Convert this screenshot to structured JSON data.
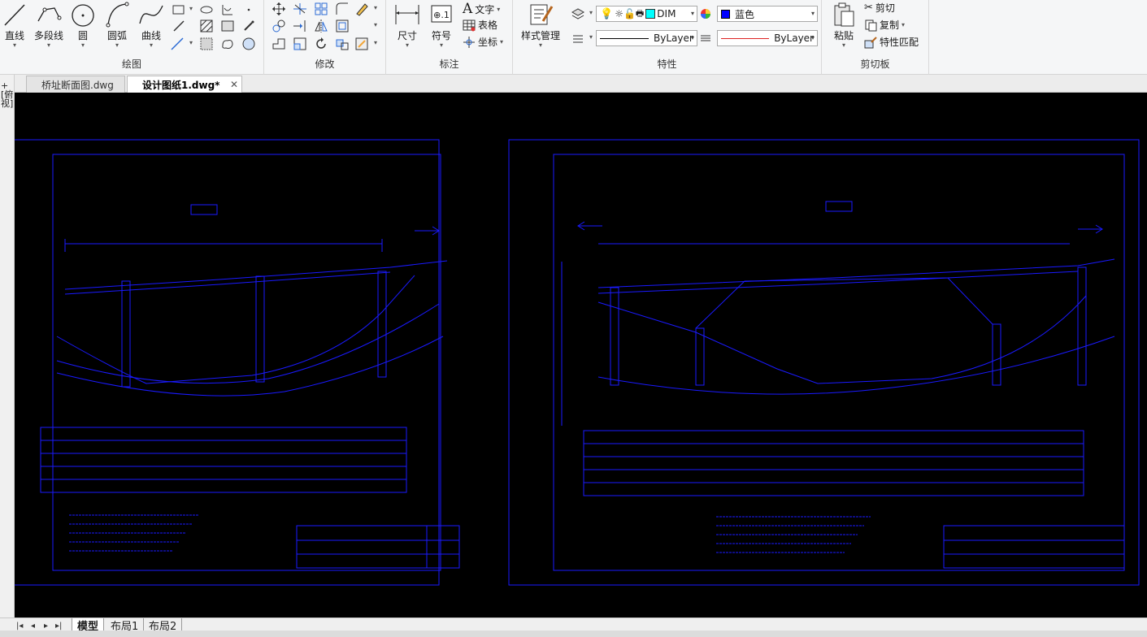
{
  "ribbon": {
    "draw": {
      "title": "绘图",
      "line_label": "直线",
      "polyline_label": "多段线",
      "circle_label": "圆",
      "arc_label": "圆弧",
      "curve_label": "曲线"
    },
    "modify": {
      "title": "修改"
    },
    "annotate": {
      "title": "标注",
      "dimension_label": "尺寸",
      "symbol_label": "符号",
      "text_label": "文字",
      "table_label": "表格",
      "coordinate_label": "坐标"
    },
    "properties": {
      "title": "特性",
      "style_manager_label": "样式管理",
      "layer_value": "DIM",
      "color_value": "蓝色",
      "linetype_value": "ByLayer",
      "lineweight_value": "ByLayer"
    },
    "clipboard": {
      "title": "剪切板",
      "paste_label": "粘贴",
      "cut_label": "剪切",
      "copy_label": "复制",
      "match_label": "特性匹配"
    }
  },
  "tabs": [
    {
      "label": "桥址断面图.dwg"
    },
    {
      "label": "设计图纸1.dwg*"
    }
  ],
  "leftstrip": {
    "text": "+[俯视]"
  },
  "layout_tabs": [
    {
      "label": "模型"
    },
    {
      "label": "布局1"
    },
    {
      "label": "布局2"
    }
  ],
  "colors": {
    "drawing_line": "#1a1aff",
    "canvas_bg": "#000000",
    "color_swatch": "#0000ff"
  }
}
